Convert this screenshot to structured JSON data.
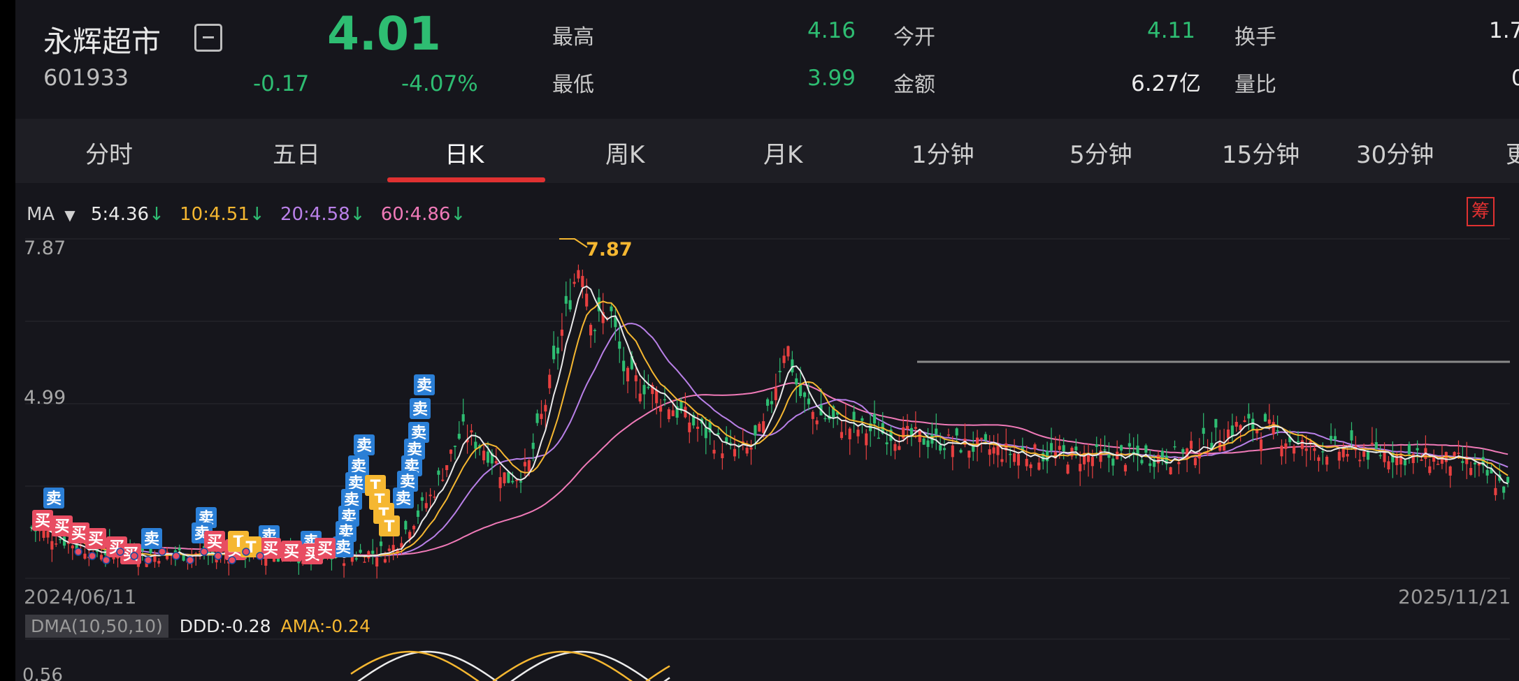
{
  "header": {
    "name": "永辉超市",
    "code": "601933",
    "price": "4.01",
    "change": "-0.17",
    "change_pct": "-4.07%",
    "stats": [
      {
        "label": "最高",
        "value": "4.16"
      },
      {
        "label": "今开",
        "value": "4.11"
      },
      {
        "label": "换手",
        "value": "1.7"
      },
      {
        "label": "最低",
        "value": "3.99"
      },
      {
        "label": "金额",
        "value": "6.27亿"
      },
      {
        "label": "量比",
        "value": "0"
      }
    ]
  },
  "tabs": [
    "分时",
    "五日",
    "日K",
    "周K",
    "月K",
    "1分钟",
    "5分钟",
    "15分钟",
    "30分钟",
    "更"
  ],
  "active_tab": "日K",
  "ma": {
    "label": "MA",
    "items": [
      {
        "text": "5:4.36",
        "color": "#eaeaea"
      },
      {
        "text": "10:4.51",
        "color": "#f5b731"
      },
      {
        "text": "20:4.58",
        "color": "#b980e8"
      },
      {
        "text": "60:4.86",
        "color": "#f07ab8"
      }
    ],
    "down_arrow": "↓",
    "chip": "筹"
  },
  "chart": {
    "y_high_label": "7.87",
    "y_mid_label": "4.99",
    "peak_label": "7.87",
    "x_start": "2024/06/11",
    "x_end": "2025/11/21",
    "markers": {
      "sell": "卖",
      "buy": "买",
      "t": "T"
    }
  },
  "dma": {
    "tag": "DMA(10,50,10)",
    "ddd": "DDD:-0.28",
    "ama": "AMA:-0.24",
    "y_label": "0.56"
  },
  "colors": {
    "up": "#e84040",
    "down": "#2ebd72",
    "ma5": "#eaeaea",
    "ma10": "#f5b731",
    "ma20": "#b980e8",
    "ma60": "#f07ab8",
    "sell_badge": "#2b7fd6",
    "buy_badge": "#e84d62"
  }
}
